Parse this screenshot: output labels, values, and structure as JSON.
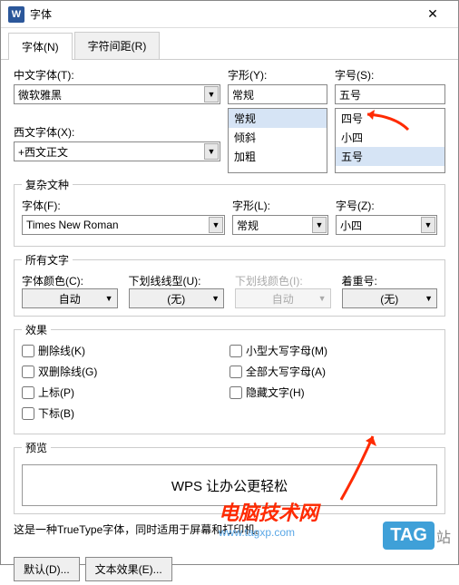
{
  "window": {
    "title": "字体",
    "icon_letter": "W"
  },
  "tabs": {
    "font": "字体(N)",
    "spacing": "字符间距(R)"
  },
  "font": {
    "cn_font_label": "中文字体(T):",
    "cn_font_value": "微软雅黑",
    "style_label": "字形(Y):",
    "style_value": "常规",
    "style_options": [
      "常规",
      "倾斜",
      "加粗"
    ],
    "size_label": "字号(S):",
    "size_value": "五号",
    "size_options": [
      "四号",
      "小四",
      "五号"
    ],
    "western_font_label": "西文字体(X):",
    "western_font_value": "+西文正文"
  },
  "complex": {
    "legend": "复杂文种",
    "font_label": "字体(F):",
    "font_value": "Times New Roman",
    "style_label": "字形(L):",
    "style_value": "常规",
    "size_label": "字号(Z):",
    "size_value": "小四"
  },
  "alltext": {
    "legend": "所有文字",
    "color_label": "字体颜色(C):",
    "color_value": "自动",
    "underline_label": "下划线线型(U):",
    "underline_value": "(无)",
    "ulcolor_label": "下划线颜色(I):",
    "ulcolor_value": "自动",
    "emphasis_label": "着重号:",
    "emphasis_value": "(无)"
  },
  "effects": {
    "legend": "效果",
    "strike": "删除线(K)",
    "dstrike": "双删除线(G)",
    "super": "上标(P)",
    "sub": "下标(B)",
    "smallcaps": "小型大写字母(M)",
    "allcaps": "全部大写字母(A)",
    "hidden": "隐藏文字(H)"
  },
  "preview": {
    "legend": "预览",
    "text": "WPS 让办公更轻松",
    "note": "这是一种TrueType字体，同时适用于屏幕和打印机。"
  },
  "buttons": {
    "default": "默认(D)...",
    "texteffect": "文本效果(E)..."
  },
  "watermark": {
    "line1": "电脑技术网",
    "line2": "www.tagxp.com",
    "badge": "TAG",
    "tail": "站"
  }
}
